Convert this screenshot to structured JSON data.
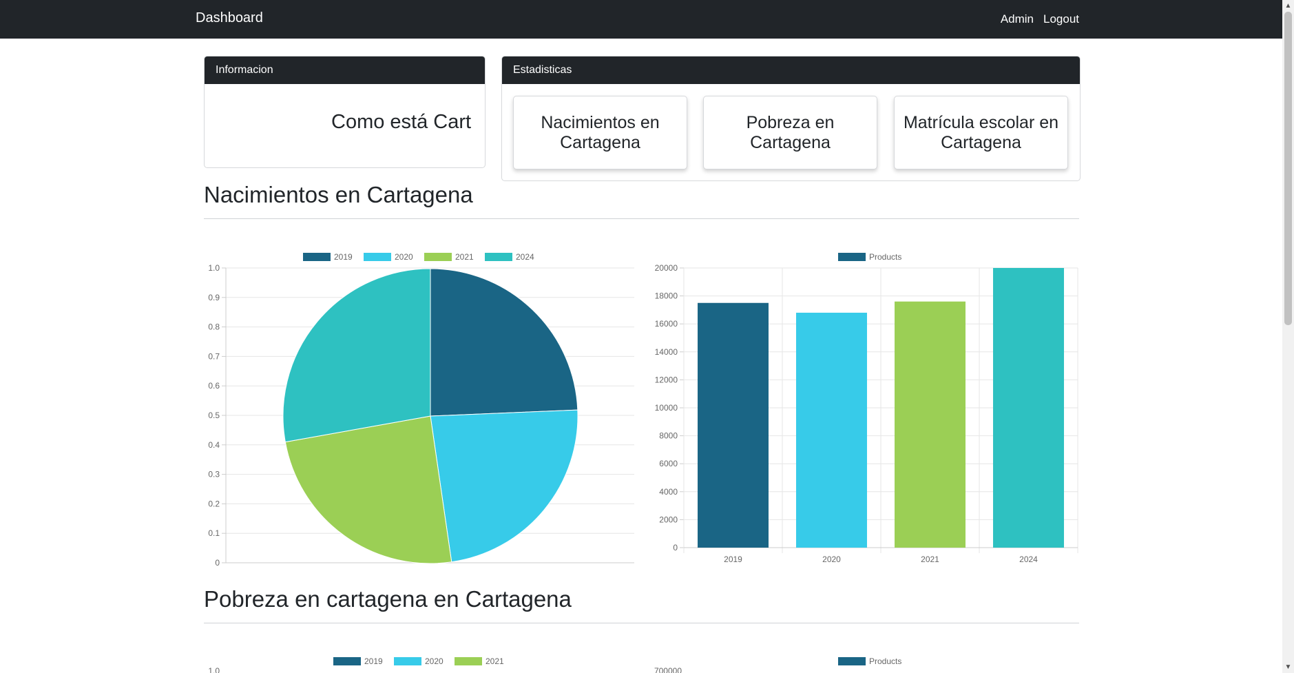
{
  "navbar": {
    "brand": "Dashboard",
    "admin": "Admin",
    "logout": "Logout"
  },
  "info_card": {
    "header": "Informacion",
    "marquee": "Como está Cartagena"
  },
  "stats_card": {
    "header": "Estadisticas",
    "items": [
      "Nacimientos en Cartagena",
      "Pobreza en Cartagena",
      "Matrícula escolar en Cartagena"
    ]
  },
  "sections": [
    {
      "title": "Nacimientos en Cartagena"
    },
    {
      "title": "Pobreza en cartagena en Cartagena"
    }
  ],
  "colors": {
    "c2019": "#1a6585",
    "c2020": "#37cbe9",
    "c2021": "#9bcf55",
    "c2024": "#2ec1c1"
  },
  "chart_data": [
    {
      "type": "pie",
      "labels": [
        "2019",
        "2020",
        "2021",
        "2024"
      ],
      "values": [
        17500,
        16800,
        17600,
        20000
      ],
      "colors": [
        "#1a6585",
        "#37cbe9",
        "#9bcf55",
        "#2ec1c1"
      ],
      "yticks": [
        "1.0",
        "0.9",
        "0.8",
        "0.7",
        "0.6",
        "0.5",
        "0.4",
        "0.3",
        "0.2",
        "0.1",
        "0"
      ],
      "ylim": [
        0,
        1
      ]
    },
    {
      "type": "bar",
      "categories": [
        "2019",
        "2020",
        "2021",
        "2024"
      ],
      "series": [
        {
          "name": "Products",
          "values": [
            17500,
            16800,
            17600,
            20000
          ]
        }
      ],
      "colors": [
        "#1a6585",
        "#37cbe9",
        "#9bcf55",
        "#2ec1c1"
      ],
      "yticks": [
        "20000",
        "18000",
        "16000",
        "14000",
        "12000",
        "10000",
        "8000",
        "6000",
        "4000",
        "2000",
        "0"
      ],
      "ylim": [
        0,
        20000
      ]
    },
    {
      "type": "pie",
      "labels": [
        "2019",
        "2020",
        "2021"
      ],
      "colors": [
        "#1a6585",
        "#37cbe9",
        "#9bcf55"
      ],
      "yticks": [
        "1.0"
      ]
    },
    {
      "type": "bar",
      "series": [
        {
          "name": "Products"
        }
      ],
      "yticks": [
        "700000"
      ]
    }
  ]
}
